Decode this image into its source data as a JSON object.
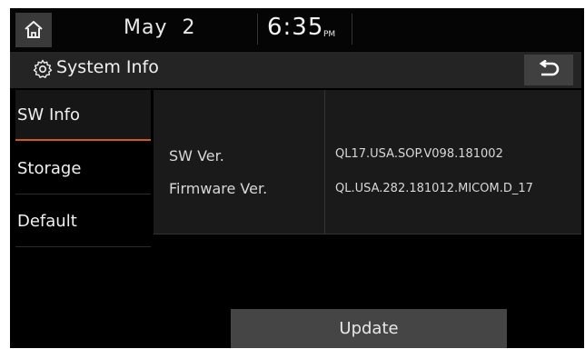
{
  "status": {
    "date": "May  2",
    "time": "6:35",
    "ampm": "PM"
  },
  "header": {
    "title": "System Info"
  },
  "sidebar": {
    "items": [
      {
        "label": "SW Info"
      },
      {
        "label": "Storage"
      },
      {
        "label": "Default"
      }
    ]
  },
  "info": {
    "rows": [
      {
        "label": "SW Ver.",
        "value": "QL17.USA.SOP.V098.181002"
      },
      {
        "label": "Firmware Ver.",
        "value": "QL.USA.282.181012.MICOM.D_17"
      }
    ]
  },
  "actions": {
    "update_label": "Update"
  },
  "colors": {
    "accent": "#d05a1c",
    "panel": "#1a1a1a",
    "button": "#454545"
  }
}
